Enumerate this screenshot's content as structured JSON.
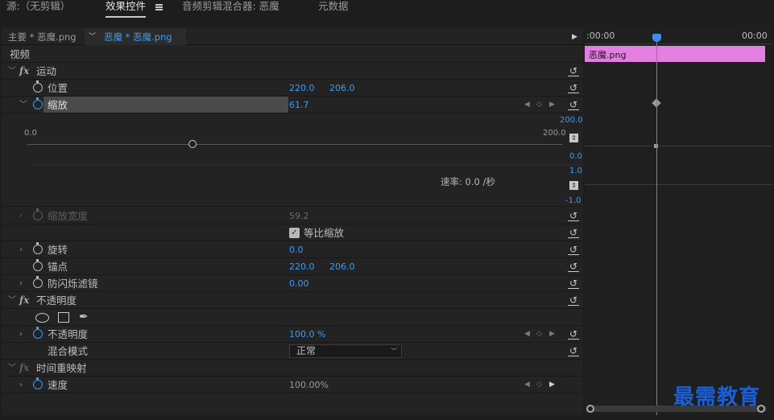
{
  "tabs": [
    {
      "label": "源:（无剪辑）",
      "active": false
    },
    {
      "label": "效果控件",
      "active": true
    },
    {
      "label": "音频剪辑混合器: 恶魔",
      "active": false
    },
    {
      "label": "元数据",
      "active": false
    }
  ],
  "clip_tabs": {
    "master": "主要 * 恶魔.png",
    "sequence": "恶魔 * 恶魔.png"
  },
  "section_video": "视频",
  "motion": {
    "title": "运动",
    "position": {
      "label": "位置",
      "x": "220.0",
      "y": "206.0"
    },
    "scale": {
      "label": "缩放",
      "value": "61.7",
      "slider_min": "0.0",
      "slider_max": "200.0",
      "slider_value_fraction": 0.308,
      "graph_top": "200.0",
      "graph_bottom": "0.0",
      "vel_top": "1.0",
      "vel_bottom": "-1.0",
      "velocity": "速率: 0.0 /秒"
    },
    "scale_width": {
      "label": "缩放宽度",
      "value": "59.2"
    },
    "uniform_scale": {
      "label": "等比缩放",
      "checked": true
    },
    "rotation": {
      "label": "旋转",
      "value": "0.0"
    },
    "anchor": {
      "label": "锚点",
      "x": "220.0",
      "y": "206.0"
    },
    "anti_flicker": {
      "label": "防闪烁滤镜",
      "value": "0.00"
    }
  },
  "opacity": {
    "title": "不透明度",
    "opacity_label": "不透明度",
    "opacity_value": "100.0 %",
    "blend_label": "混合模式",
    "blend_value": "正常"
  },
  "time_remap": {
    "title": "时间重映射",
    "speed_label": "速度",
    "speed_value": "100.00%"
  },
  "timeline": {
    "time_left": ":00:00",
    "time_right": "00:00",
    "clip_name": "恶魔.png",
    "clip_color": "#e27fe0",
    "playhead_color": "#3d8ee6"
  },
  "watermark": "最需教育"
}
